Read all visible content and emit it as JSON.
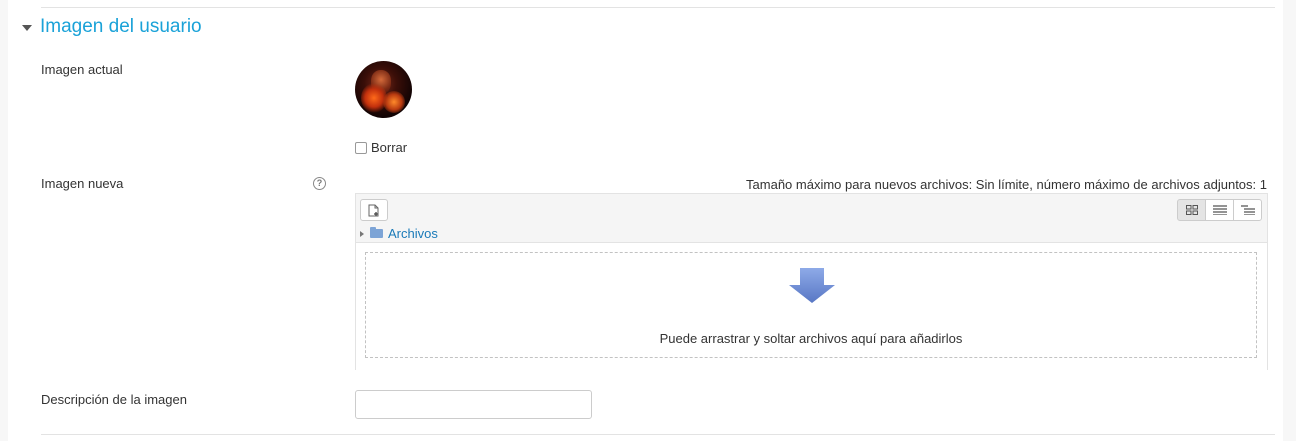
{
  "section": {
    "title": "Imagen del usuario"
  },
  "current_image": {
    "label": "Imagen actual",
    "delete_label": "Borrar"
  },
  "new_image": {
    "label": "Imagen nueva",
    "max_info": "Tamaño máximo para nuevos archivos: Sin límite, número máximo de archivos adjuntos: 1",
    "path_label": "Archivos",
    "drop_text": "Puede arrastrar y soltar archivos aquí para añadirlos"
  },
  "description": {
    "label": "Descripción de la imagen",
    "value": ""
  },
  "colors": {
    "link": "#1aa2d8",
    "drop_arrow": "#6c8fd6"
  }
}
